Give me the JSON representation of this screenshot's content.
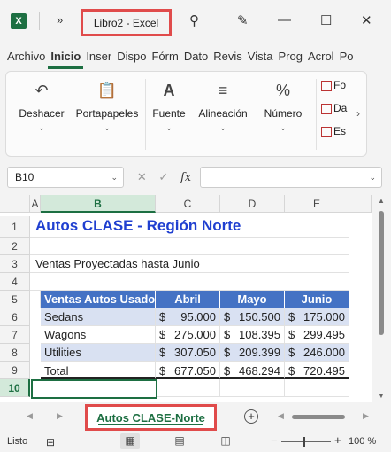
{
  "titlebar": {
    "app_icon": "X",
    "more_label": "»",
    "title": "Libro2  -  Excel",
    "search_icon": "⚲",
    "magic_icon": "✎",
    "minimize_icon": "—",
    "maximize_icon": "☐",
    "close_icon": "✕"
  },
  "ribbon_tabs": [
    "Archivo",
    "Inicio",
    "Insertar",
    "Disposición",
    "Fórmulas",
    "Datos",
    "Revisar",
    "Vista",
    "Programador",
    "Acrobat",
    "Power Pivot"
  ],
  "ribbon_tabs_visible": [
    "Archivo",
    "Inicio",
    "Inser",
    "Dispo",
    "Fórm",
    "Dato",
    "Revis",
    "Vista",
    "Prog",
    "Acrol",
    "Po"
  ],
  "ribbon": {
    "groups": [
      {
        "label": "Deshacer",
        "icon": "↶"
      },
      {
        "label": "Portapapeles",
        "icon": "📋"
      },
      {
        "label": "Fuente",
        "icon": "A"
      },
      {
        "label": "Alineación",
        "icon": "≡"
      },
      {
        "label": "Número",
        "icon": "%"
      }
    ],
    "side_items": [
      "Fo",
      "Da",
      "Es"
    ],
    "chevron": "›",
    "dropdown": "⌄"
  },
  "formula_bar": {
    "name_box": "B10",
    "cancel": "✕",
    "enter": "✓",
    "fx": "fx",
    "value": ""
  },
  "grid": {
    "columns": [
      "A",
      "B",
      "C",
      "D",
      "E"
    ],
    "rows": [
      "1",
      "2",
      "3",
      "4",
      "5",
      "6",
      "7",
      "8",
      "9",
      "10"
    ],
    "title": "Autos CLASE - Región Norte",
    "subtitle": "Ventas Proyectadas hasta Junio",
    "headers": [
      "Ventas Autos Usados",
      "Abril",
      "Mayo",
      "Junio"
    ],
    "data_rows": [
      {
        "label": "Sedans",
        "values": [
          "95.000",
          "150.500",
          "175.000"
        ]
      },
      {
        "label": "Wagons",
        "values": [
          "275.000",
          "108.395",
          "299.495"
        ]
      },
      {
        "label": "Utilities",
        "values": [
          "307.050",
          "209.399",
          "246.000"
        ]
      },
      {
        "label": "Total",
        "values": [
          "677.050",
          "468.294",
          "720.495"
        ]
      }
    ],
    "currency": "$"
  },
  "sheets": {
    "active": "Autos CLASE-Norte",
    "add_icon": "+",
    "prev": "◀",
    "next": "▶"
  },
  "statusbar": {
    "status": "Listo",
    "zoom": "100 %",
    "minus": "−",
    "plus": "+"
  }
}
